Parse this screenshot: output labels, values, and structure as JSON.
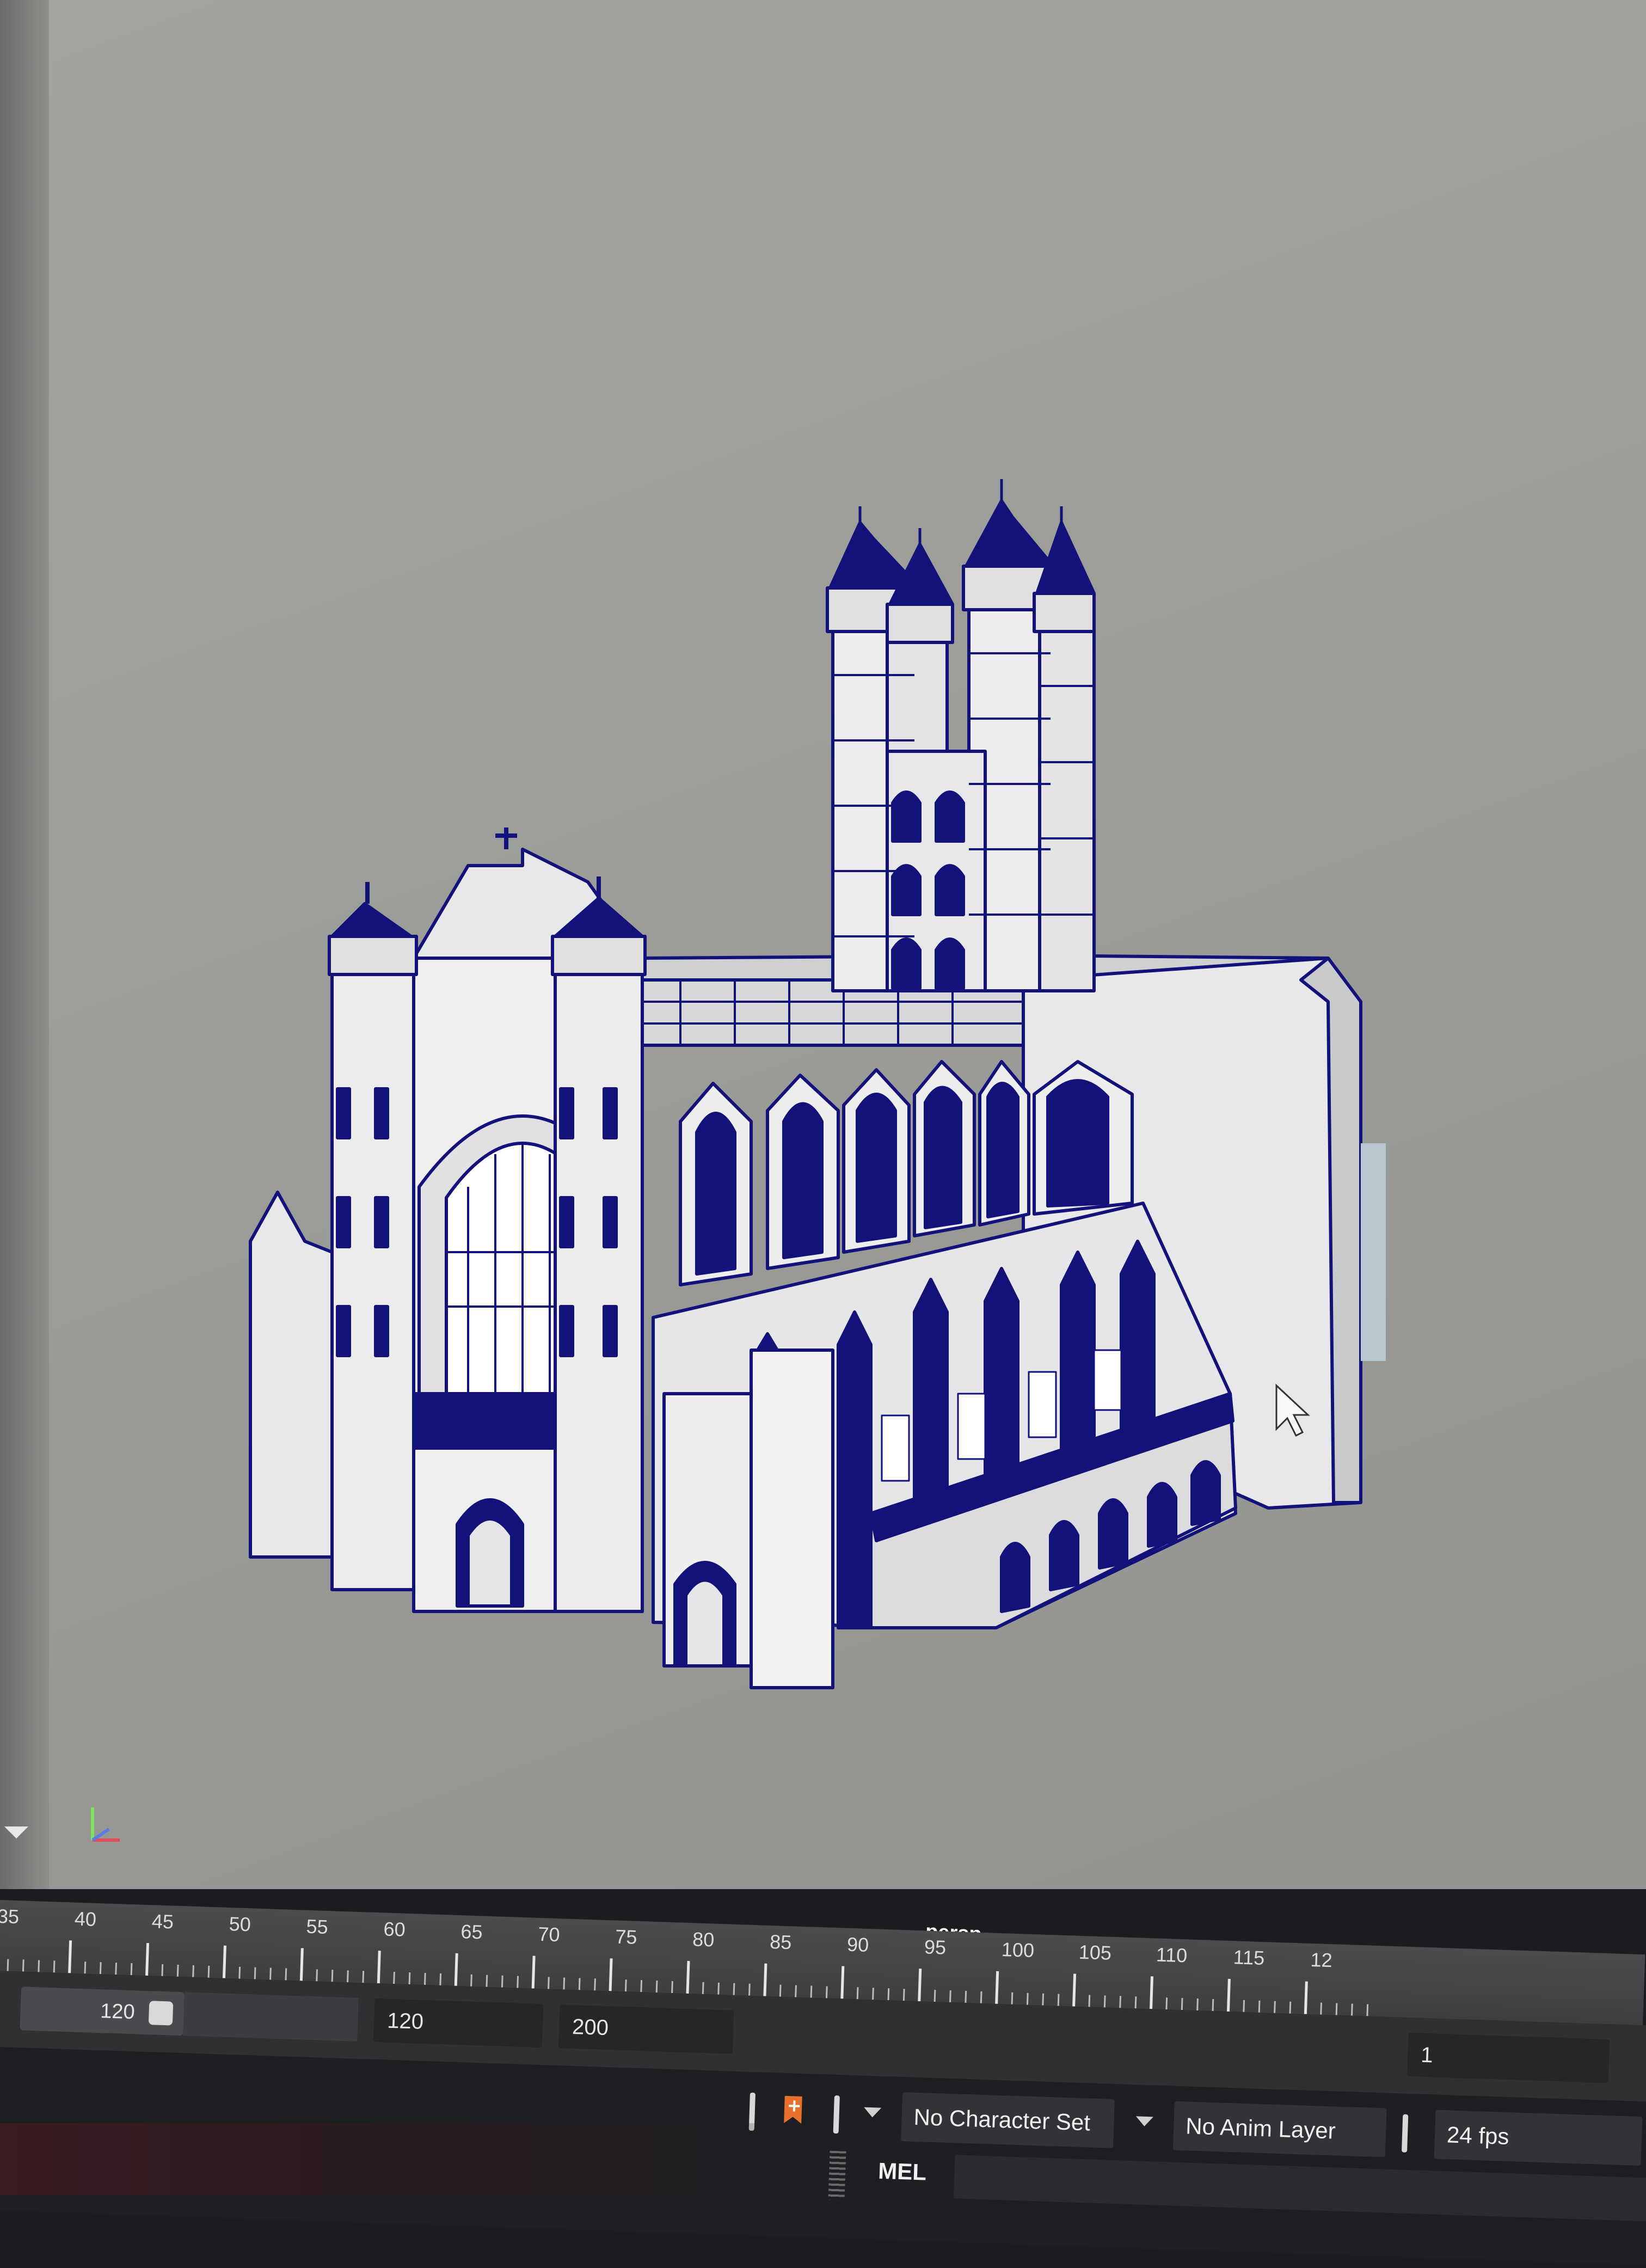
{
  "viewport": {
    "camera_label": "persp",
    "wire_color": "#12127a",
    "surface_color": "#ececec",
    "background_color": "#9e9f9b"
  },
  "timeline": {
    "ticks": [
      "35",
      "40",
      "45",
      "50",
      "55",
      "60",
      "65",
      "70",
      "75",
      "80",
      "85",
      "90",
      "95",
      "100",
      "105",
      "110",
      "115",
      "12"
    ]
  },
  "range": {
    "start_handle": "120",
    "playback_end": "120",
    "animation_end": "200",
    "current_frame": "1"
  },
  "controls": {
    "character_set": "No Character Set",
    "anim_layer": "No Anim Layer",
    "fps": "24 fps"
  },
  "command_line": {
    "language": "MEL"
  },
  "icons": {
    "axis_gizmo": "axis-gizmo-icon",
    "key": "auto-key-icon",
    "panel_toggle": "triangle-down-icon",
    "cursor": "mouse-pointer-icon"
  }
}
